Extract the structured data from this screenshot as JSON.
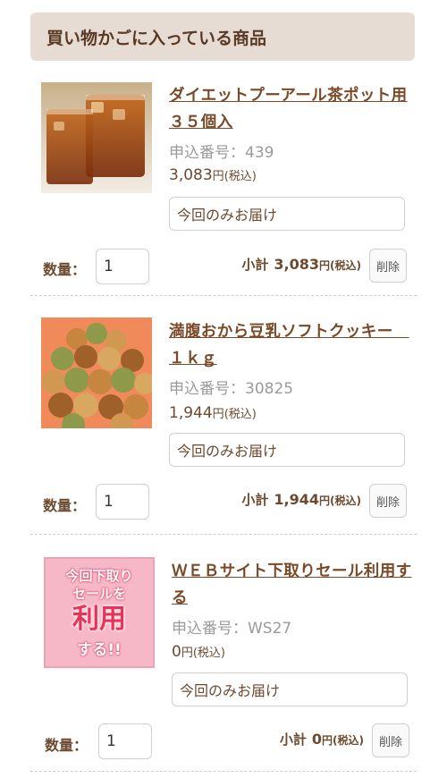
{
  "header": {
    "title": "買い物かごに入っている商品"
  },
  "labels": {
    "code_prefix": "申込番号：",
    "qty": "数量：",
    "subtotal": "小計",
    "tax": "(税込)",
    "yen": "円",
    "delete": "削除"
  },
  "items": [
    {
      "title": "ダイエットプーアール茶ポット用３５個入",
      "code": "439",
      "price": "3,083",
      "delivery": "今回のみお届け",
      "qty": "1",
      "subtotal": "3,083",
      "image_icon": "tea-glass-image"
    },
    {
      "title": "満腹おから豆乳ソフトクッキー　１ｋｇ",
      "code": "30825",
      "price": "1,944",
      "delivery": "今回のみお届け",
      "qty": "1",
      "subtotal": "1,944",
      "image_icon": "cookies-image"
    },
    {
      "title": "ＷＥＢサイト下取りセール利用する",
      "code": "WS27",
      "price": "0",
      "delivery": "今回のみお届け",
      "qty": "1",
      "subtotal": "0",
      "image_icon": "trade-in-banner-image",
      "promo": {
        "line1": "今回下取り",
        "line1b": "セールを",
        "line2": "利用",
        "line3": "する!!"
      }
    }
  ],
  "colors": {
    "header_bg": "#e6dcd4",
    "title": "#7a4a28",
    "text": "#6b4a2f"
  }
}
